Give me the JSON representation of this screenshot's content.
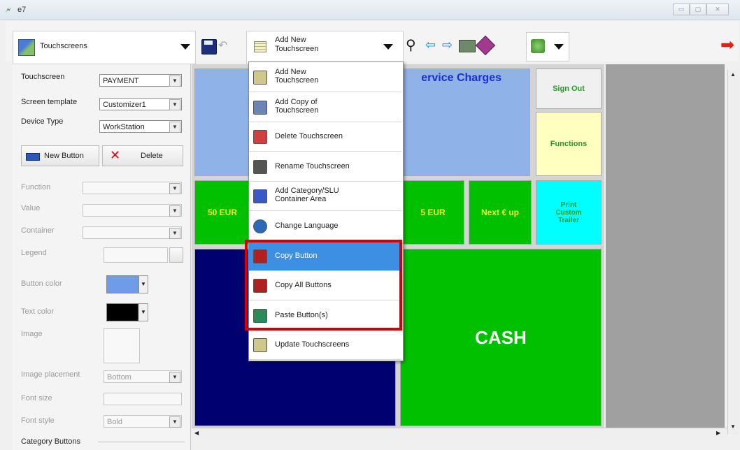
{
  "window": {
    "title": "e7"
  },
  "toolbar": {
    "touchscreens_label": "Touchscreens",
    "add_action": [
      "Add New",
      "Touchscreen"
    ]
  },
  "left_panel": {
    "touchscreen_label": "Touchscreen",
    "touchscreen_value": "PAYMENT",
    "template_label": "Screen template",
    "template_value": "Customizer1",
    "device_label": "Device Type",
    "device_value": "WorkStation",
    "new_button": "New Button",
    "delete_button": "Delete",
    "function_label": "Function",
    "value_label": "Value",
    "container_label": "Container",
    "legend_label": "Legend",
    "button_color_label": "Button color",
    "text_color_label": "Text color",
    "image_label": "Image",
    "image_placement_label": "Image placement",
    "image_placement_value": "Bottom",
    "font_size_label": "Font size",
    "font_style_label": "Font style",
    "font_style_value": "Bold",
    "category_buttons_label": "Category Buttons",
    "button_color": "#6f9ce8",
    "text_color": "#000000"
  },
  "canvas": {
    "service_charges": "ervice Charges",
    "sign_out": "Sign Out",
    "functions": "Functions",
    "eur50": "50 EUR",
    "eur5": "5 EUR",
    "next_eur": "Next € up",
    "print_trailer": [
      "Print",
      "Custom",
      "Trailer"
    ],
    "cash": "CASH"
  },
  "menu": {
    "items": [
      {
        "label": [
          "Add New",
          "Touchscreen"
        ],
        "icon": "grid-icon"
      },
      {
        "label": [
          "Add Copy of",
          "Touchscreen"
        ],
        "icon": "copy-icon"
      },
      {
        "label": [
          "Delete Touchscreen"
        ],
        "icon": "delete-grid-icon"
      },
      {
        "label": [
          "Rename Touchscreen"
        ],
        "icon": "rename-icon"
      },
      {
        "label": [
          "Add Category/SLU",
          "Container Area"
        ],
        "icon": "container-icon"
      },
      {
        "label": [
          "Change Language"
        ],
        "icon": "globe-icon"
      },
      {
        "label": [
          "Copy Button"
        ],
        "icon": "copy-button-icon",
        "selected": true
      },
      {
        "label": [
          "Copy All Buttons"
        ],
        "icon": "copy-all-icon"
      },
      {
        "label": [
          "Paste Button(s)"
        ],
        "icon": "paste-icon"
      },
      {
        "label": [
          "Update Touchscreens"
        ],
        "icon": "update-icon"
      }
    ]
  },
  "colors": {
    "green": "#00c000",
    "navy": "#000070",
    "light_blue": "#8fb2e8",
    "yellow": "#ffffc0",
    "cyan": "#00ffff",
    "highlight_red": "#d20000"
  }
}
